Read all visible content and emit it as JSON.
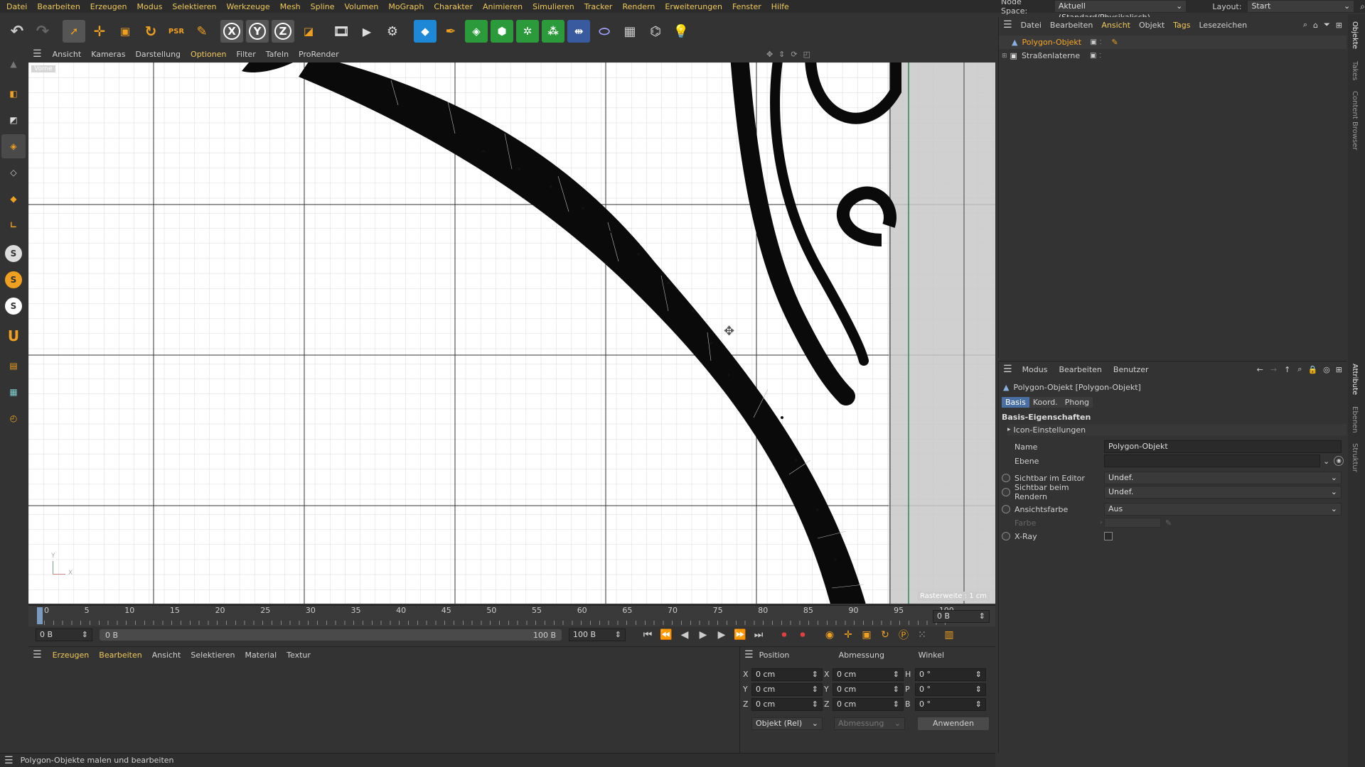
{
  "menubar": {
    "items": [
      "Datei",
      "Bearbeiten",
      "Erzeugen",
      "Modus",
      "Selektieren",
      "Werkzeuge",
      "Mesh",
      "Spline",
      "Volumen",
      "MoGraph",
      "Charakter",
      "Animieren",
      "Simulieren",
      "Tracker",
      "Rendern",
      "Erweiterungen",
      "Fenster",
      "Hilfe"
    ],
    "node_space_label": "Node Space:",
    "node_space_value": "Aktuell (Standard/Physikalisch)",
    "layout_label": "Layout:",
    "layout_value": "Start"
  },
  "toolbar": {
    "icons": [
      "undo-icon",
      "redo-icon",
      "select-icon",
      "move-icon",
      "scale-icon",
      "rotate-icon",
      "psr-icon",
      "live-select-icon",
      "x-axis-icon",
      "y-axis-icon",
      "z-axis-icon",
      "coord-system-icon",
      "render-view-icon",
      "render-picture-viewer-icon",
      "render-settings-icon",
      "cube-icon",
      "pen-icon",
      "subdivision-icon",
      "extrude-icon",
      "cloner-icon",
      "mograph-icon",
      "deformer-icon",
      "environment-icon",
      "floor-icon",
      "camera-icon",
      "light-icon"
    ],
    "axis_labels": [
      "X",
      "Y",
      "Z"
    ]
  },
  "left_toolbar": {
    "icons": [
      "model-mode-icon",
      "object-mode-icon",
      "texture-mode-icon",
      "points-mode-icon",
      "edges-mode-icon",
      "polygons-mode-icon",
      "axis-mode-icon",
      "snap-icon",
      "soft-selection-icon",
      "symmetry-icon",
      "magnet-icon",
      "workplane-icon",
      "lock-workplane-icon",
      "quantize-icon"
    ],
    "s_labels": [
      "S",
      "S",
      "S"
    ]
  },
  "viewport": {
    "menu": [
      "Ansicht",
      "Kameras",
      "Darstellung",
      "Optionen",
      "Filter",
      "Tafeln",
      "ProRender"
    ],
    "active_menu": "Optionen",
    "view_label": "Vorne",
    "grid_label": "Rasterweite : 1 cm",
    "axis_x": "X",
    "axis_y": "Y"
  },
  "timeline": {
    "ticks": [
      "0",
      "5",
      "10",
      "15",
      "20",
      "25",
      "30",
      "35",
      "40",
      "45",
      "50",
      "55",
      "60",
      "65",
      "70",
      "75",
      "80",
      "85",
      "90",
      "95",
      "100"
    ],
    "current_frame": "0 B",
    "start_field": "0 B",
    "range_start": "0 B",
    "range_end": "100 B",
    "end_field": "100 B"
  },
  "materials": {
    "menu": [
      "Erzeugen",
      "Bearbeiten",
      "Ansicht",
      "Selektieren",
      "Material",
      "Textur"
    ]
  },
  "coordinates": {
    "headers": [
      "Position",
      "Abmessung",
      "Winkel"
    ],
    "rows": [
      {
        "axis": "X",
        "pos": "0 cm",
        "dim_axis": "X",
        "dim": "0 cm",
        "ang_axis": "H",
        "ang": "0 °"
      },
      {
        "axis": "Y",
        "pos": "0 cm",
        "dim_axis": "Y",
        "dim": "0 cm",
        "ang_axis": "P",
        "ang": "0 °"
      },
      {
        "axis": "Z",
        "pos": "0 cm",
        "dim_axis": "Z",
        "dim": "0 cm",
        "ang_axis": "B",
        "ang": "0 °"
      }
    ],
    "mode_select": "Objekt (Rel)",
    "size_select": "Abmessung",
    "apply_button": "Anwenden"
  },
  "objects_panel": {
    "menu": [
      "Datei",
      "Bearbeiten",
      "Ansicht",
      "Objekt",
      "Tags",
      "Lesezeichen"
    ],
    "active_menu": "Ansicht",
    "items": [
      {
        "name": "Polygon-Objekt",
        "selected": true
      },
      {
        "name": "Straßenlaterne",
        "selected": false
      }
    ]
  },
  "attributes_panel": {
    "menu": [
      "Modus",
      "Bearbeiten",
      "Benutzer"
    ],
    "title": "Polygon-Objekt [Polygon-Objekt]",
    "tabs": [
      "Basis",
      "Koord.",
      "Phong"
    ],
    "active_tab": "Basis",
    "section": "Basis-Eigenschaften",
    "subsection": "Icon-Einstellungen",
    "fields": {
      "name_label": "Name",
      "name_value": "Polygon-Objekt",
      "ebene_label": "Ebene",
      "ebene_value": "",
      "editor_label": "Sichtbar im Editor",
      "editor_value": "Undef.",
      "render_label": "Sichtbar beim Rendern",
      "render_value": "Undef.",
      "farbe_mode_label": "Ansichtsfarbe",
      "farbe_mode_value": "Aus",
      "farbe_label": "Farbe",
      "xray_label": "X-Ray"
    }
  },
  "side_tabs_top": [
    "Objekte",
    "Takes",
    "Content Browser"
  ],
  "side_tabs_bottom": [
    "Attribute",
    "Ebenen",
    "Struktur"
  ],
  "status": "Polygon-Objekte malen und bearbeiten",
  "colors": {
    "accent": "#f0c95a",
    "selected_object": "#f5a623",
    "bg": "#333333",
    "viewport_bg": "#ffffff"
  }
}
